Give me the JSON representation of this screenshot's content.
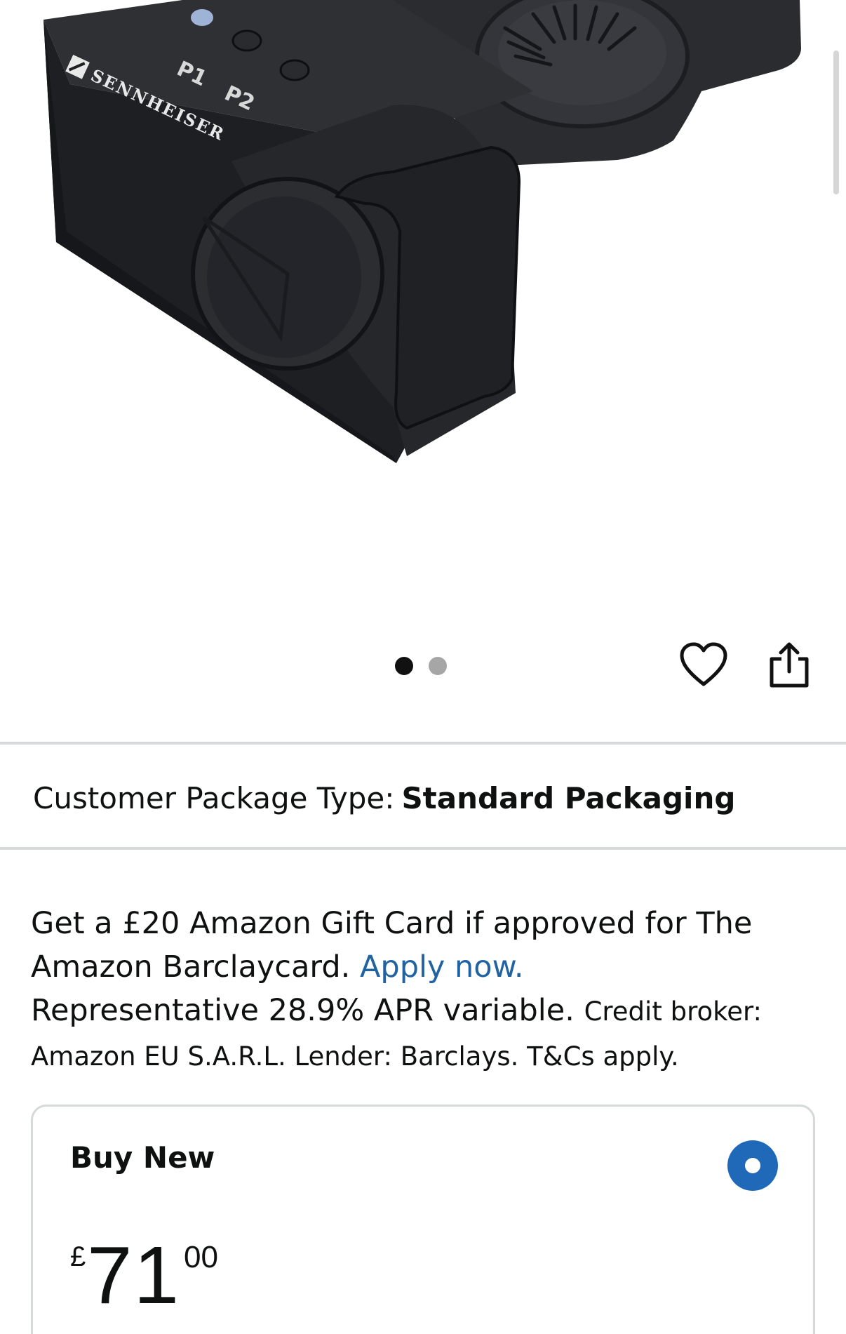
{
  "product_image": {
    "brand_text": "SENNHEISER",
    "button_labels": [
      "P1",
      "P2"
    ]
  },
  "carousel": {
    "count": 2,
    "active_index": 0
  },
  "package": {
    "label": "Customer Package Type:",
    "value": "Standard Packaging"
  },
  "promo": {
    "text_1": "Get a £20 Amazon Gift Card if approved for The Amazon Barclaycard.",
    "link": "Apply now.",
    "text_2": "Representative 28.9% APR variable.",
    "text_small": "Credit broker: Amazon EU S.A.R.L. Lender: Barclays. T&Cs apply."
  },
  "buy_new": {
    "title": "Buy New",
    "selected": true,
    "price": {
      "symbol": "£",
      "whole": "71",
      "fraction": "00"
    }
  },
  "colors": {
    "link": "#2162a1",
    "radio_selected": "#1f69b8",
    "divider": "#d5d9d9",
    "text": "#0f1111"
  }
}
